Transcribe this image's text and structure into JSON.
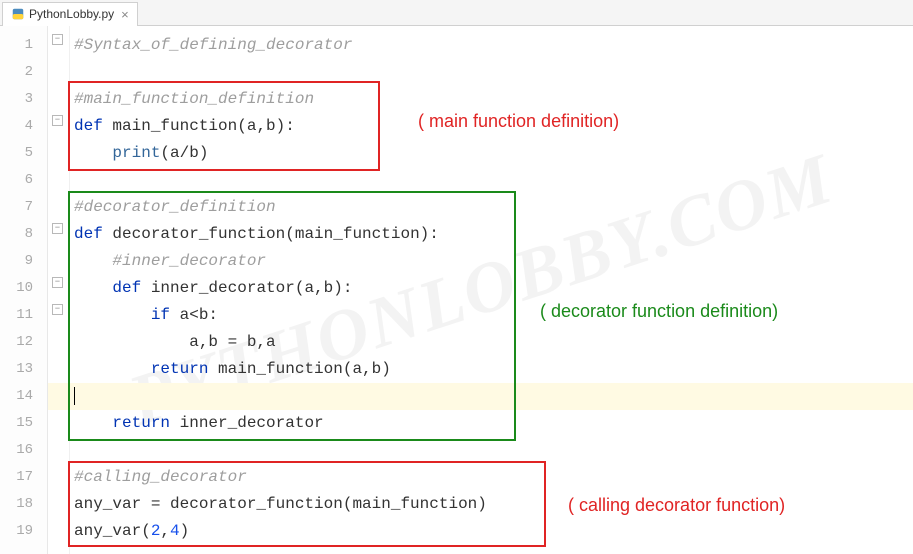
{
  "tab": {
    "filename": "PythonLobby.py"
  },
  "watermark": "PYTHONLOBBY.COM",
  "annotations": {
    "main": "( main function definition)",
    "decorator": "( decorator function definition)",
    "calling": "( calling decorator function)"
  },
  "code": {
    "line1_comment": "#Syntax_of_defining_decorator",
    "line3_comment": "#main_function_definition",
    "line4_def": "def",
    "line4_name": " main_function(a,b):",
    "line5_print": "print",
    "line5_rest": "(a/b)",
    "line7_comment": "#decorator_definition",
    "line8_def": "def",
    "line8_name": " decorator_function(main_function):",
    "line9_comment": "#inner_decorator",
    "line10_def": "def",
    "line10_name": " inner_decorator(a,b):",
    "line11_if": "if",
    "line11_rest": " a<b:",
    "line12": "a,b = b,a",
    "line13_return": "return",
    "line13_rest": " main_function(a,b)",
    "line15_return": "return",
    "line15_rest": " inner_decorator",
    "line17_comment": "#calling_decorator",
    "line18": "any_var = decorator_function(main_function)",
    "line19_a": "any_var(",
    "line19_n1": "2",
    "line19_c": ",",
    "line19_n2": "4",
    "line19_b": ")"
  }
}
